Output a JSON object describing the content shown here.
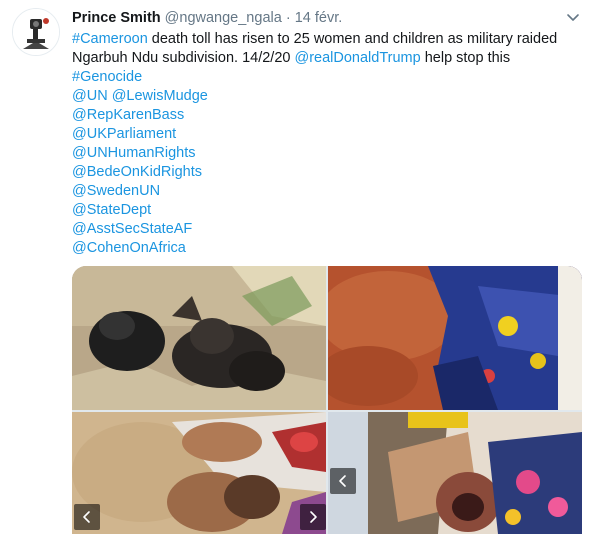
{
  "tweet": {
    "author_name": "Prince Smith",
    "handle": "@ngwange_ngala",
    "separator": "·",
    "date": "14 févr.",
    "line1_link": "#Cameroon",
    "line1_text": " death toll has risen to 25 women and children as military raided",
    "line2_text": "Ngarbuh Ndu subdivision. 14/2/20 ",
    "line2_link": "@realDonaldTrump",
    "line2_tail": " help stop this",
    "hashtag": "#Genocide",
    "mention_row_1": [
      "@UN",
      "@LewisMudge"
    ],
    "mentions": [
      "@RepKarenBass",
      "@UKParliament",
      "@UNHumanRights",
      "@BedeOnKidRights",
      "@SwedenUN",
      "@StateDept",
      "@AsstSecStateAF",
      "@CohenOnAfrica"
    ]
  },
  "colors": {
    "link": "#1b95e0",
    "text": "#14171a",
    "muted": "#657786"
  },
  "icons": {
    "menu": "chevron-down-icon",
    "prev": "chevron-left-icon",
    "next": "chevron-right-icon"
  }
}
